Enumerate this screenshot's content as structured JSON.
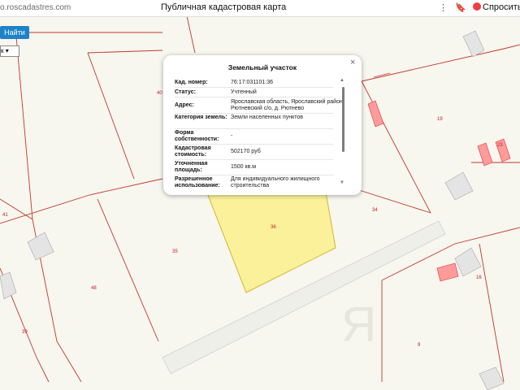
{
  "browser": {
    "url": "o.roscadastres.com",
    "page_title": "Публичная кадастровая карта",
    "ask_label": "Спросить"
  },
  "toolbar": {
    "find_label": "Найти",
    "select_value": "к"
  },
  "map": {
    "plot_labels": [
      "40",
      "19",
      "41",
      "35",
      "36",
      "34",
      "48",
      "39",
      "16",
      "9",
      "23"
    ],
    "watermark": "Я"
  },
  "popup": {
    "title": "Земельный участок",
    "rows": [
      {
        "key": "Кад. номер:",
        "value": "76:17:031101:36"
      },
      {
        "key": "Статус:",
        "value": "Учтенный"
      },
      {
        "key": "Адрес:",
        "value": "Ярославская область, Ярославский район, Рютневский с/о, д. Рютнево"
      },
      {
        "key": "Категория земель:",
        "value": "Земли населенных пунктов"
      },
      {
        "key": "Форма собственности:",
        "value": "-"
      },
      {
        "key": "Кадастровая стоимость:",
        "value": "502170 руб"
      },
      {
        "key": "Уточненная площадь:",
        "value": "1500 кв.м"
      },
      {
        "key": "Разрешенное использование:",
        "value": "Для индивидуального жилищного строительства"
      }
    ]
  },
  "colors": {
    "boundary": "#c0392b",
    "selected_fill": "#fbf19a",
    "button": "#1e82c8"
  }
}
